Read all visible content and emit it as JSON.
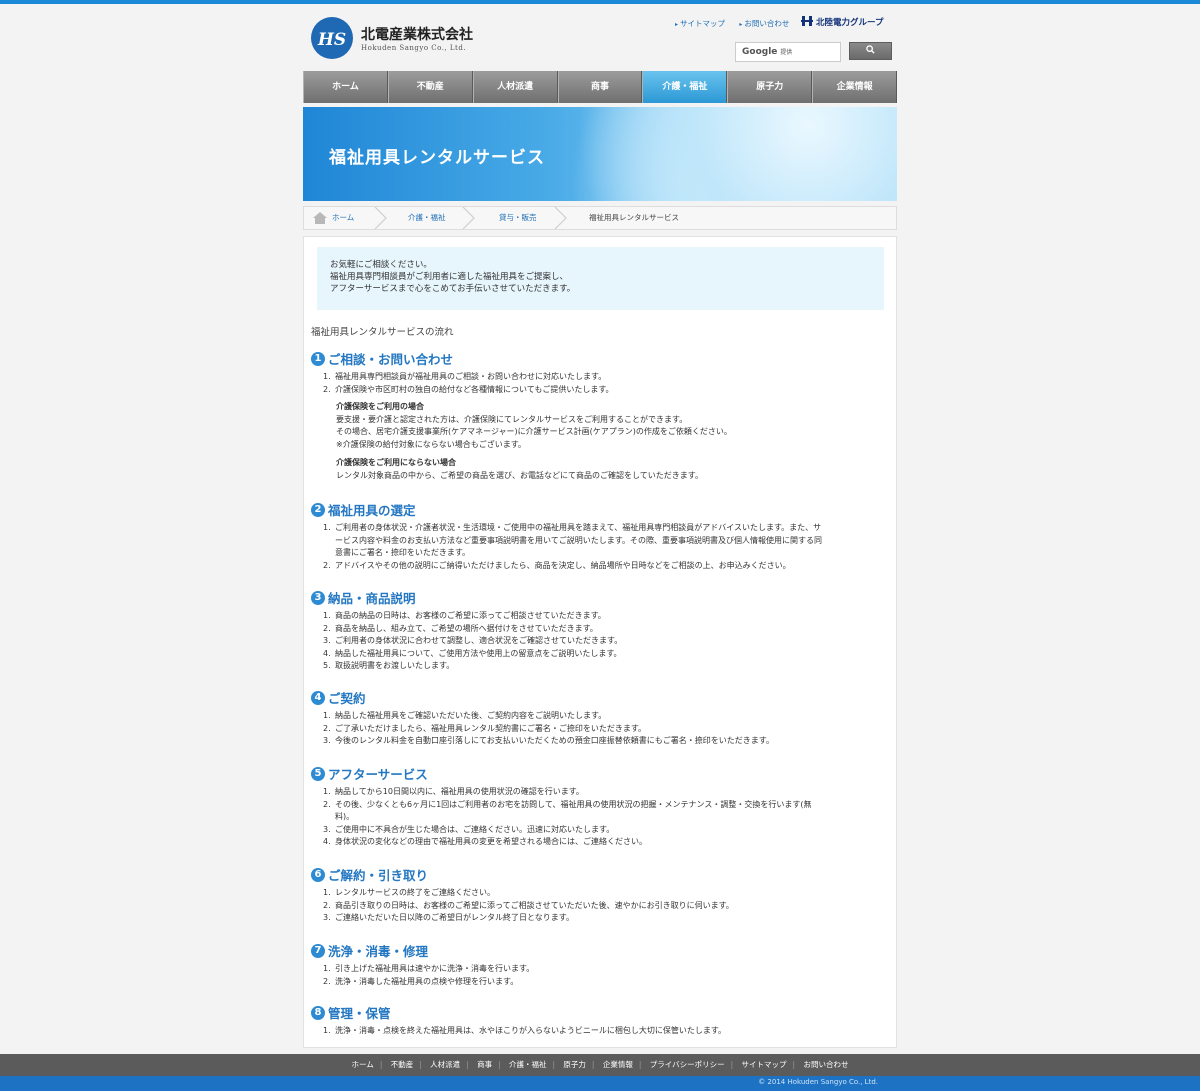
{
  "header": {
    "company_name": "北電産業株式会社",
    "company_roman": "Hokuden Sangyo Co., Ltd.",
    "toplinks": [
      "サイトマップ",
      "お問い合わせ"
    ],
    "group_logo": "北陸電力グループ",
    "search_placeholder": "Google",
    "search_provider": "提供",
    "search_button_icon": "search-icon"
  },
  "nav": [
    "ホーム",
    "不動産",
    "人材派遣",
    "商事",
    "介護・福祉",
    "原子力",
    "企業情報"
  ],
  "hero": {
    "title": "福祉用具レンタルサービス"
  },
  "breadcrumb": [
    "ホーム",
    "介護・福祉",
    "貸与・販売",
    "福祉用具レンタルサービス"
  ],
  "intro": [
    "お気軽にご相談ください。",
    "福祉用具専門相談員がご利用者に適した福祉用具をご提案し、",
    "アフターサービスまで心をこめてお手伝いさせていただきます。"
  ],
  "flow_title": "福祉用具レンタルサービスの流れ",
  "steps": [
    {
      "num": "1",
      "title": "ご相談・お問い合わせ",
      "items": [
        "福祉用具専門相談員が福祉用具のご相談・お問い合わせに対応いたします。",
        "介護保険や市区町村の独自の給付など各種情報についてもご提供いたします。"
      ],
      "sub1_head": "介護保険をご利用の場合",
      "sub1_lines": [
        "要支援・要介護と認定された方は、介護保険にてレンタルサービスをご利用することができます。",
        "その場合、居宅介護支援事業所(ケアマネージャー)に介護サービス計画(ケアプラン)の作成をご依頼ください。",
        "※介護保険の給付対象にならない場合もございます。"
      ],
      "sub2_head": "介護保険をご利用にならない場合",
      "sub2_lines": [
        "レンタル対象商品の中から、ご希望の商品を選び、お電話などにて商品のご確認をしていただきます。"
      ]
    },
    {
      "num": "2",
      "title": "福祉用具の選定",
      "items": [
        "ご利用者の身体状況・介護者状況・生活環境・ご使用中の福祉用具を踏まえて、福祉用具専門相談員がアドバイスいたします。また、サ",
        "ービス内容や料金のお支払い方法など重要事項説明書を用いてご説明いたします。その際、重要事項説明書及び個人情報使用に関する同",
        "意書にご署名・捺印をいただきます。",
        "アドバイスやその他の説明にご納得いただけましたら、商品を決定し、納品場所や日時などをご相談の上、お申込みください。"
      ]
    },
    {
      "num": "3",
      "title": "納品・商品説明",
      "items": [
        "商品の納品の日時は、お客様のご希望に添ってご相談させていただきます。",
        "商品を納品し、組み立て、ご希望の場所へ据付けをさせていただきます。",
        "ご利用者の身体状況に合わせて調整し、適合状況をご確認させていただきます。",
        "納品した福祉用具について、ご使用方法や使用上の留意点をご説明いたします。",
        "取扱説明書をお渡しいたします。"
      ]
    },
    {
      "num": "4",
      "title": "ご契約",
      "items": [
        "納品した福祉用具をご確認いただいた後、ご契約内容をご説明いたします。",
        "ご了承いただけましたら、福祉用具レンタル契約書にご署名・ご捺印をいただきます。",
        "今後のレンタル料金を自動口座引落しにてお支払いいただくための預金口座振替依頼書にもご署名・捺印をいただきます。"
      ]
    },
    {
      "num": "5",
      "title": "アフターサービス",
      "items": [
        "納品してから10日間以内に、福祉用具の使用状況の確認を行います。",
        "その後、少なくとも6ヶ月に1回はご利用者のお宅を訪問して、福祉用具の使用状況の把握・メンテナンス・調整・交換を行います(無",
        "料)。",
        "ご使用中に不具合が生じた場合は、ご連絡ください。迅速に対応いたします。",
        "身体状況の変化などの理由で福祉用具の変更を希望される場合には、ご連絡ください。"
      ]
    },
    {
      "num": "6",
      "title": "ご解約・引き取り",
      "items": [
        "レンタルサービスの終了をご連絡ください。",
        "商品引き取りの日時は、お客様のご希望に添ってご相談させていただいた後、速やかにお引き取りに伺います。",
        "ご連絡いただいた日以降のご希望日がレンタル終了日となります。"
      ]
    },
    {
      "num": "7",
      "title": "洗浄・消毒・修理",
      "items": [
        "引き上げた福祉用具は速やかに洗浄・消毒を行います。",
        "洗浄・消毒した福祉用具の点検や修理を行います。"
      ]
    },
    {
      "num": "8",
      "title": "管理・保管",
      "items": [
        "洗浄・消毒・点検を終えた福祉用具は、水やほこりが入らないようビニールに梱包し大切に保管いたします。"
      ]
    }
  ],
  "footer": {
    "links": [
      "ホーム",
      "不動産",
      "人材派遣",
      "商事",
      "介護・福祉",
      "原子力",
      "企業情報",
      "プライバシーポリシー",
      "サイトマップ",
      "お問い合わせ"
    ],
    "copyright": "© 2014 Hokuden Sangyo Co., Ltd."
  }
}
